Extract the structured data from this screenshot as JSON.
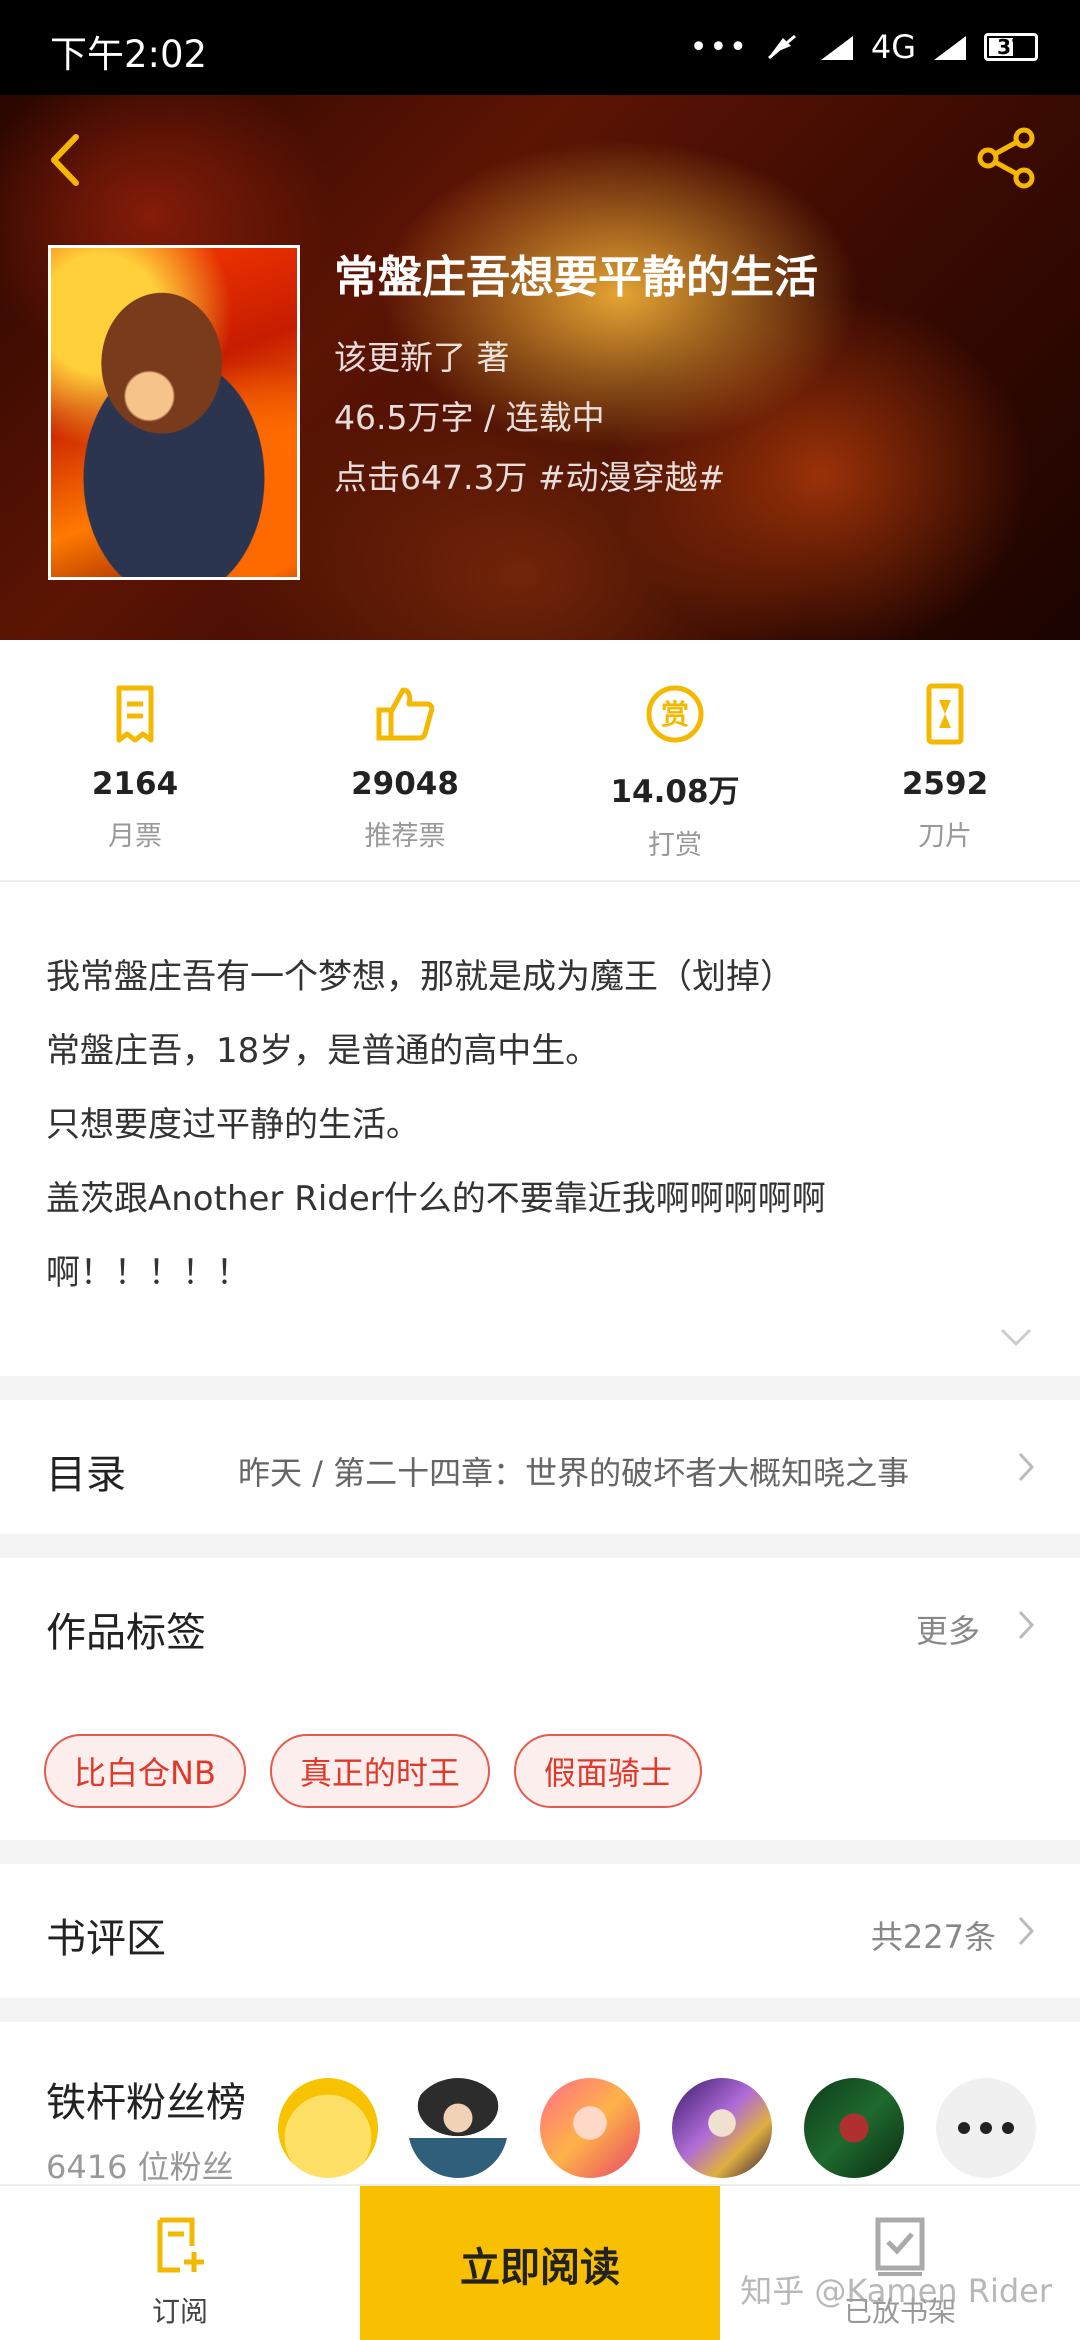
{
  "status_bar": {
    "time": "下午2:02",
    "network": "4G",
    "battery": "37"
  },
  "book": {
    "title": "常盤庄吾想要平静的生活",
    "author": "该更新了  著",
    "words_status": "46.5万字 / 连载中",
    "clicks_tag": "点击647.3万  #动漫穿越#"
  },
  "stats": [
    {
      "icon": "ticket-icon",
      "value": "2164",
      "label": "月票"
    },
    {
      "icon": "thumbs-up-icon",
      "value": "29048",
      "label": "推荐票"
    },
    {
      "icon": "reward-icon",
      "value": "14.08万",
      "label": "打赏"
    },
    {
      "icon": "blade-icon",
      "value": "2592",
      "label": "刀片"
    }
  ],
  "description": [
    "我常盤庄吾有一个梦想，那就是成为魔王（划掉）",
    "常盤庄吾，18岁，是普通的高中生。",
    "只想要度过平静的生活。",
    "盖茨跟Another Rider什么的不要靠近我啊啊啊啊啊",
    "啊！！！！！"
  ],
  "catalog": {
    "title": "目录",
    "latest": "昨天 / 第二十四章：世界的破坏者大概知晓之事"
  },
  "tags_section": {
    "title": "作品标签",
    "more": "更多",
    "tags": [
      "比白仓NB",
      "真正的时王",
      "假面骑士"
    ]
  },
  "reviews": {
    "title": "书评区",
    "count": "共227条"
  },
  "fans": {
    "title": "铁杆粉丝榜",
    "count": "6416 位粉丝"
  },
  "bottom_bar": {
    "subscribe": "订阅",
    "read_now": "立即阅读",
    "shelf": "已放书架"
  },
  "watermark": "知乎 @Kamen Rider",
  "colors": {
    "accent": "#f8c000",
    "tag_red": "#e0392a",
    "icon_yellow": "#f5b800"
  }
}
